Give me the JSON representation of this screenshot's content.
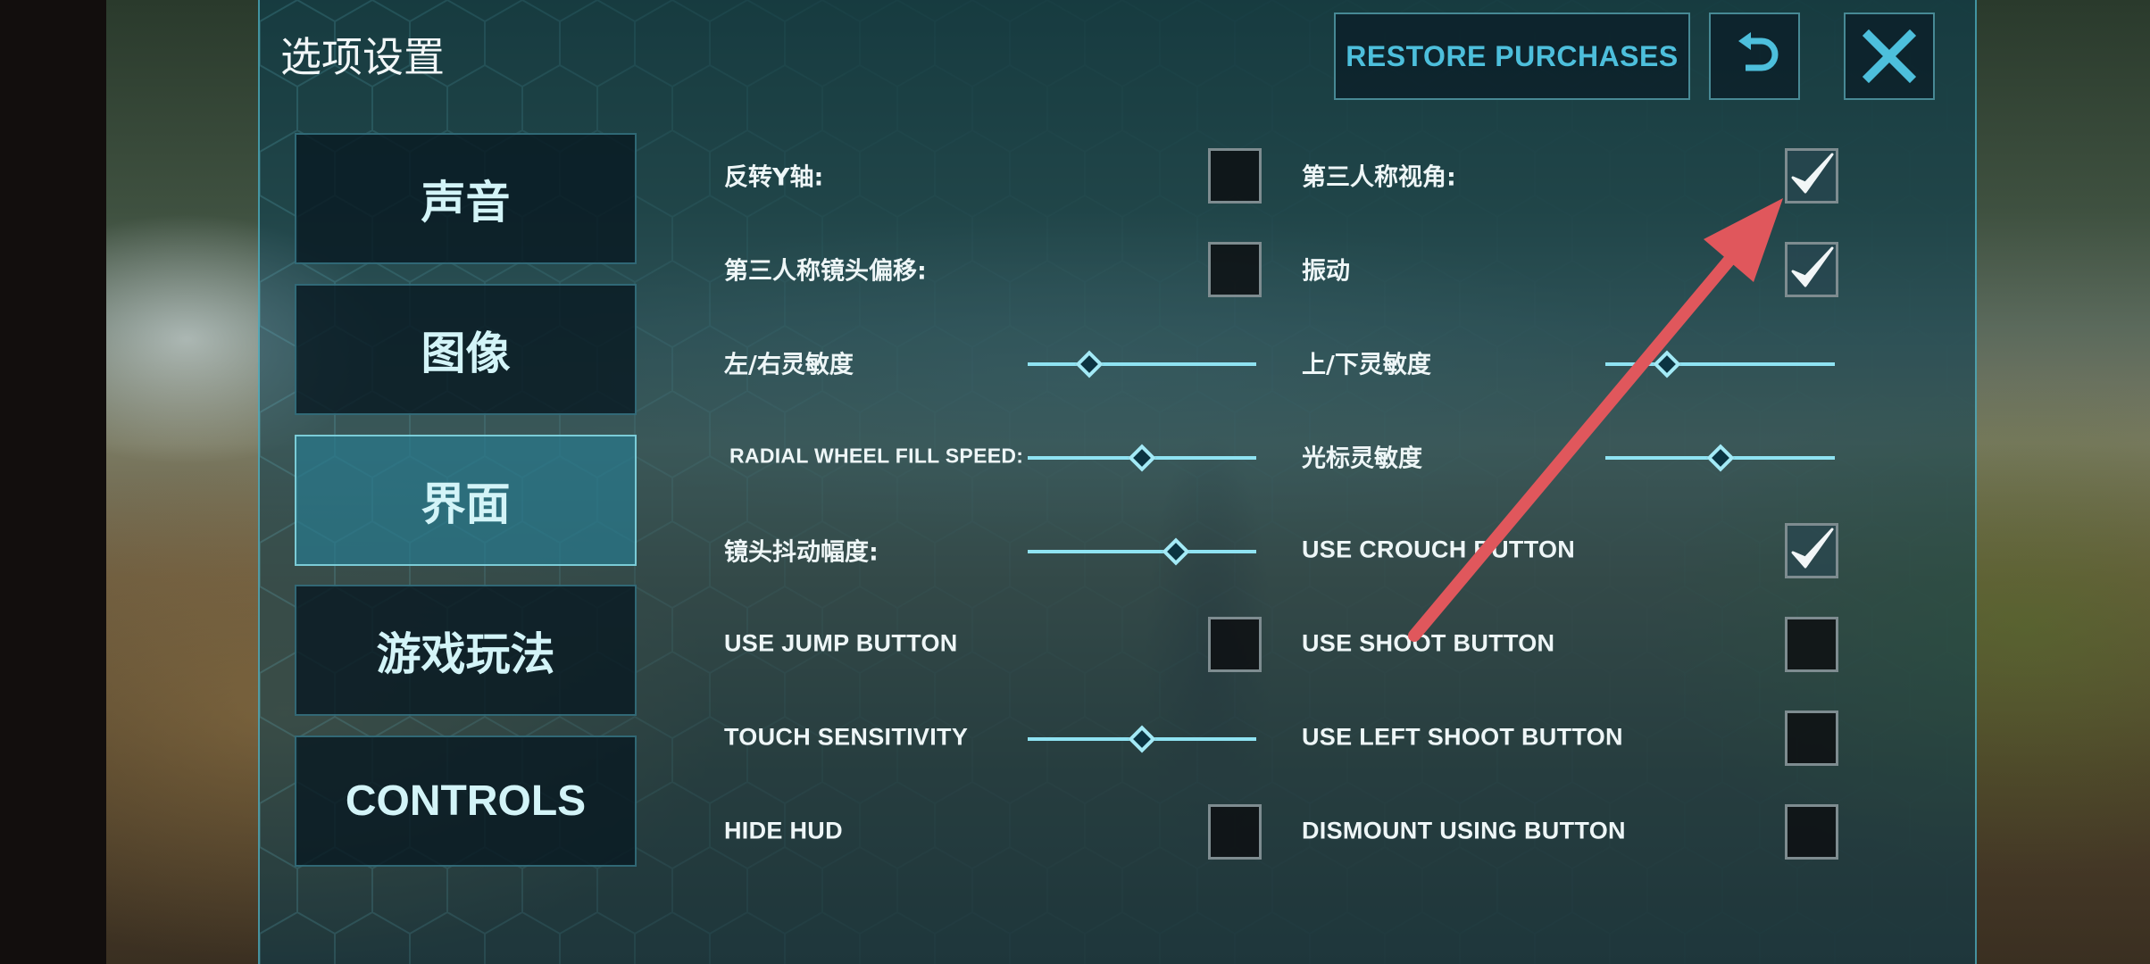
{
  "title": "选项设置",
  "header": {
    "restore_label": "RESTORE PURCHASES",
    "undo_icon": "undo-icon",
    "close_icon": "close-icon"
  },
  "tabs": [
    {
      "label": "声音",
      "active": false
    },
    {
      "label": "图像",
      "active": false
    },
    {
      "label": "界面",
      "active": true
    },
    {
      "label": "游戏玩法",
      "active": false
    },
    {
      "label": "CONTROLS",
      "active": false
    }
  ],
  "settings": {
    "invert_y": {
      "label": "反转Y轴:",
      "checked": false
    },
    "third_person_view": {
      "label": "第三人称视角:",
      "checked": true
    },
    "third_person_offset": {
      "label": "第三人称镜头偏移:",
      "checked": false
    },
    "vibration": {
      "label": "振动",
      "checked": true
    },
    "lr_sensitivity": {
      "label": "左/右灵敏度",
      "value": 0.27
    },
    "ud_sensitivity": {
      "label": "上/下灵敏度",
      "value": 0.27
    },
    "radial_wheel": {
      "label": "RADIAL WHEEL FILL SPEED:",
      "value": 0.5
    },
    "cursor_sensitivity": {
      "label": "光标灵敏度",
      "value": 0.5
    },
    "camera_shake": {
      "label": "镜头抖动幅度:",
      "value": 0.65
    },
    "use_crouch": {
      "label": "USE CROUCH BUTTON",
      "checked": true
    },
    "use_jump": {
      "label": "USE JUMP BUTTON",
      "checked": false
    },
    "use_shoot": {
      "label": "USE SHOOT BUTTON",
      "checked": false
    },
    "touch_sensitivity": {
      "label": "TOUCH SENSITIVITY",
      "value": 0.5
    },
    "use_left_shoot": {
      "label": "USE LEFT SHOOT BUTTON",
      "checked": false
    },
    "hide_hud": {
      "label": "HIDE HUD",
      "checked": false
    },
    "dismount_button": {
      "label": "DISMOUNT USING BUTTON",
      "checked": false
    }
  },
  "colors": {
    "accent": "#4dbfdc",
    "annotation_arrow": "#e0575c",
    "panel": "#093c50"
  }
}
